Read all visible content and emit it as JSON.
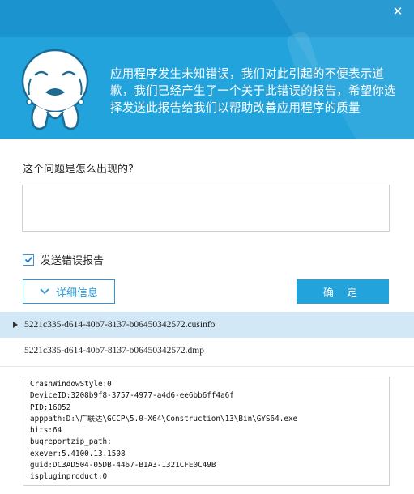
{
  "header": {
    "close_glyph": "✕",
    "message": "应用程序发生未知错误，我们对此引起的不便表示道歉，我们已经产生了一个关于此错误的报告，希望你选择发送此报告给我们以帮助改善应用程序的质量"
  },
  "form": {
    "question": "这个问题是怎么出现的?",
    "description_value": "",
    "send_report_label": "发送错误报告",
    "send_report_checked": true
  },
  "buttons": {
    "details_label": "详细信息",
    "ok_label": "确 定"
  },
  "files": [
    {
      "name": "5221c335-d614-40b7-8137-b06450342572.cusinfo",
      "selected": true
    },
    {
      "name": "5221c335-d614-40b7-8137-b06450342572.dmp",
      "selected": false
    }
  ],
  "file_content": [
    "CrashWindowStyle:0",
    "DeviceID:3208b9f8-3757-4977-a4d6-ee6bb6ff4a6f",
    "PID:16052",
    "apppath:D:\\广联达\\GCCP\\5.0-X64\\Construction\\13\\Bin\\GYS64.exe",
    "bits:64",
    "bugreportzip_path:",
    "exever:5.4100.13.1508",
    "guid:DC3AD504-05DB-4467-B1A3-1321CFE0C49B",
    "ispluginproduct:0"
  ],
  "colors": {
    "header_blue": "#22a3dc",
    "topbar_blue": "#1a93cf",
    "accent": "#2a9bd8",
    "selected_row": "#d3e8f7"
  }
}
